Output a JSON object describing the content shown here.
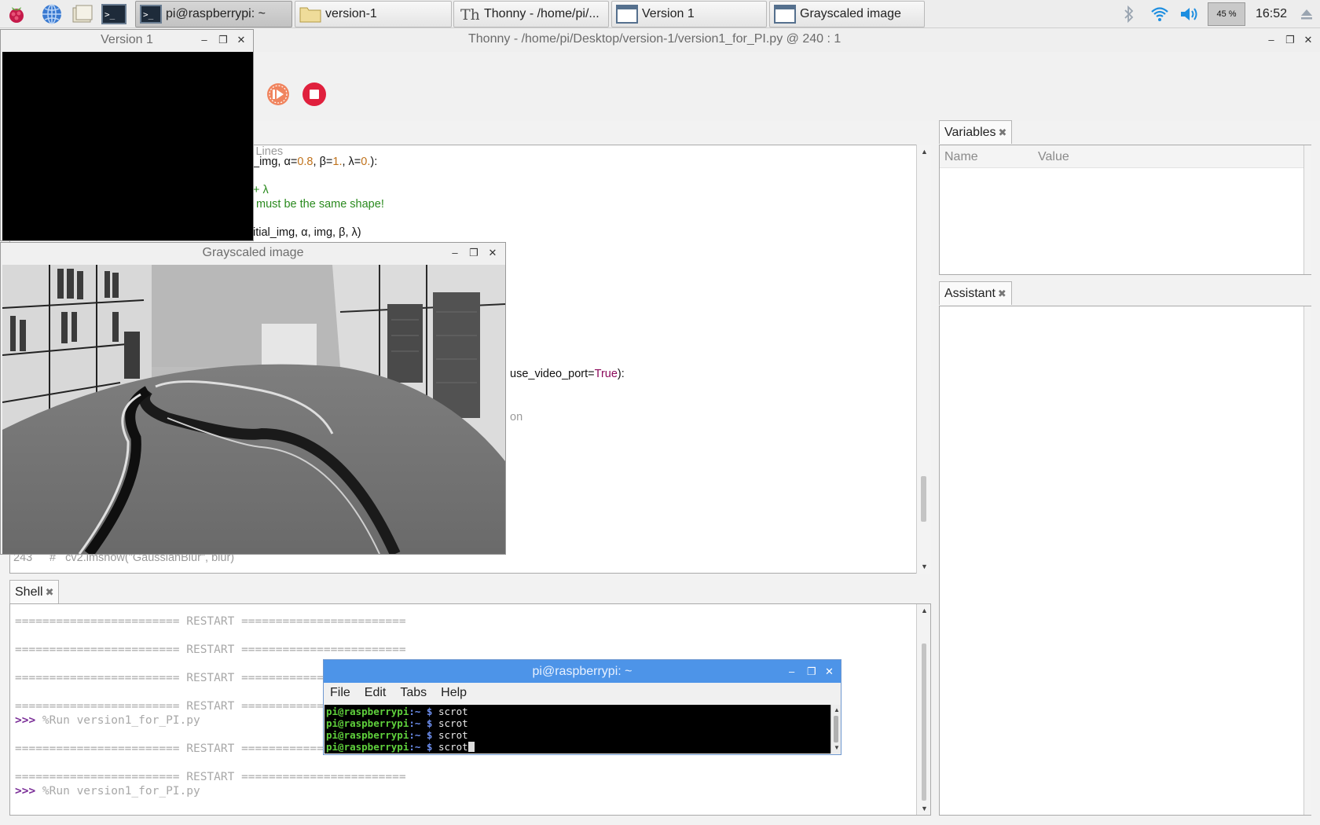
{
  "taskbar": {
    "tasks": [
      {
        "label": "pi@raspberrypi: ~"
      },
      {
        "label": "version-1"
      },
      {
        "label": "Thonny  -  /home/pi/..."
      },
      {
        "label": "Version 1"
      },
      {
        "label": "Grayscaled image"
      }
    ],
    "cpu": "45 %",
    "clock": "16:52"
  },
  "thonny": {
    "title": "Thonny  -  /home/pi/Desktop/version-1/version1_for_PI.py  @  240 : 1",
    "editor": {
      "line_partial_comment": "= Lines",
      "line1_a": "_img, α=",
      "line1_n1": "0.8",
      "line1_b": ", β=",
      "line1_n2": "1.",
      "line1_c": ", λ=",
      "line1_n3": "0.",
      "line1_d": "):",
      "line2": "+ λ",
      "line3": " must be the same shape!",
      "line4": "itial_img, α, img, β, λ)",
      "line5_a": "use_video_port=",
      "line5_kw": "True",
      "line5_b": "):",
      "line6": "on",
      "gutter_243": "243",
      "line243": "#   cv2.imshow(\"GaussianBlur\", blur)"
    },
    "shell": {
      "tab": "Shell",
      "restart": "======================== RESTART ========================",
      "prompt": ">>>",
      "run_cmd": " %Run version1_for_PI.py"
    },
    "variables": {
      "tab": "Variables",
      "col_name": "Name",
      "col_value": "Value"
    },
    "assistant": {
      "tab": "Assistant"
    }
  },
  "version1_window": {
    "title": "Version 1"
  },
  "grayscaled_window": {
    "title": "Grayscaled image"
  },
  "terminal": {
    "title": "pi@raspberrypi: ~",
    "menu": [
      "File",
      "Edit",
      "Tabs",
      "Help"
    ],
    "user": "pi@raspberrypi",
    "path": ":~ $",
    "command": " scrot"
  },
  "colors": {
    "accent_blue": "#4d94e8",
    "stop_red": "#e0203d",
    "resume_orange": "#f0845e"
  }
}
